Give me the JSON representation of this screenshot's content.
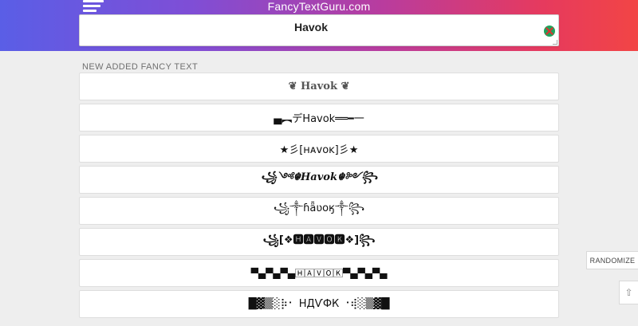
{
  "header": {
    "site_title": "FancyTextGuru.com",
    "menu_icon": "hamburger-menu-icon",
    "gradient_colors": [
      "#5a5ee6",
      "#b93c9e",
      "#f24545"
    ]
  },
  "search": {
    "value": "Havok",
    "clear_icon": "clear-icon"
  },
  "section": {
    "title": "NEW ADDED FANCY TEXT"
  },
  "fancy_texts": [
    "❦ Havok ❦",
    "▄︻デHavok══━一",
    "★彡[ʜᴀᴠᴏᴋ]彡★",
    "꧁༺☬𝑯𝒂𝒗𝒐𝒌☬༻꧂",
    "꧁༒ɦǟʋօӄ༒꧂",
    "꧁[❖🅷🅰🆅🅾🅺❖]꧂",
    "▀▄▀▄▀▄🄷🄰🅅🄾🄺▀▄▀▄▀▄",
    "█▓▒░⡷⠂ НДѴФК ⠐⢾░▒▓█"
  ],
  "side_buttons": {
    "randomize": "RANDOMIZE",
    "scroll_top": "⇧"
  }
}
